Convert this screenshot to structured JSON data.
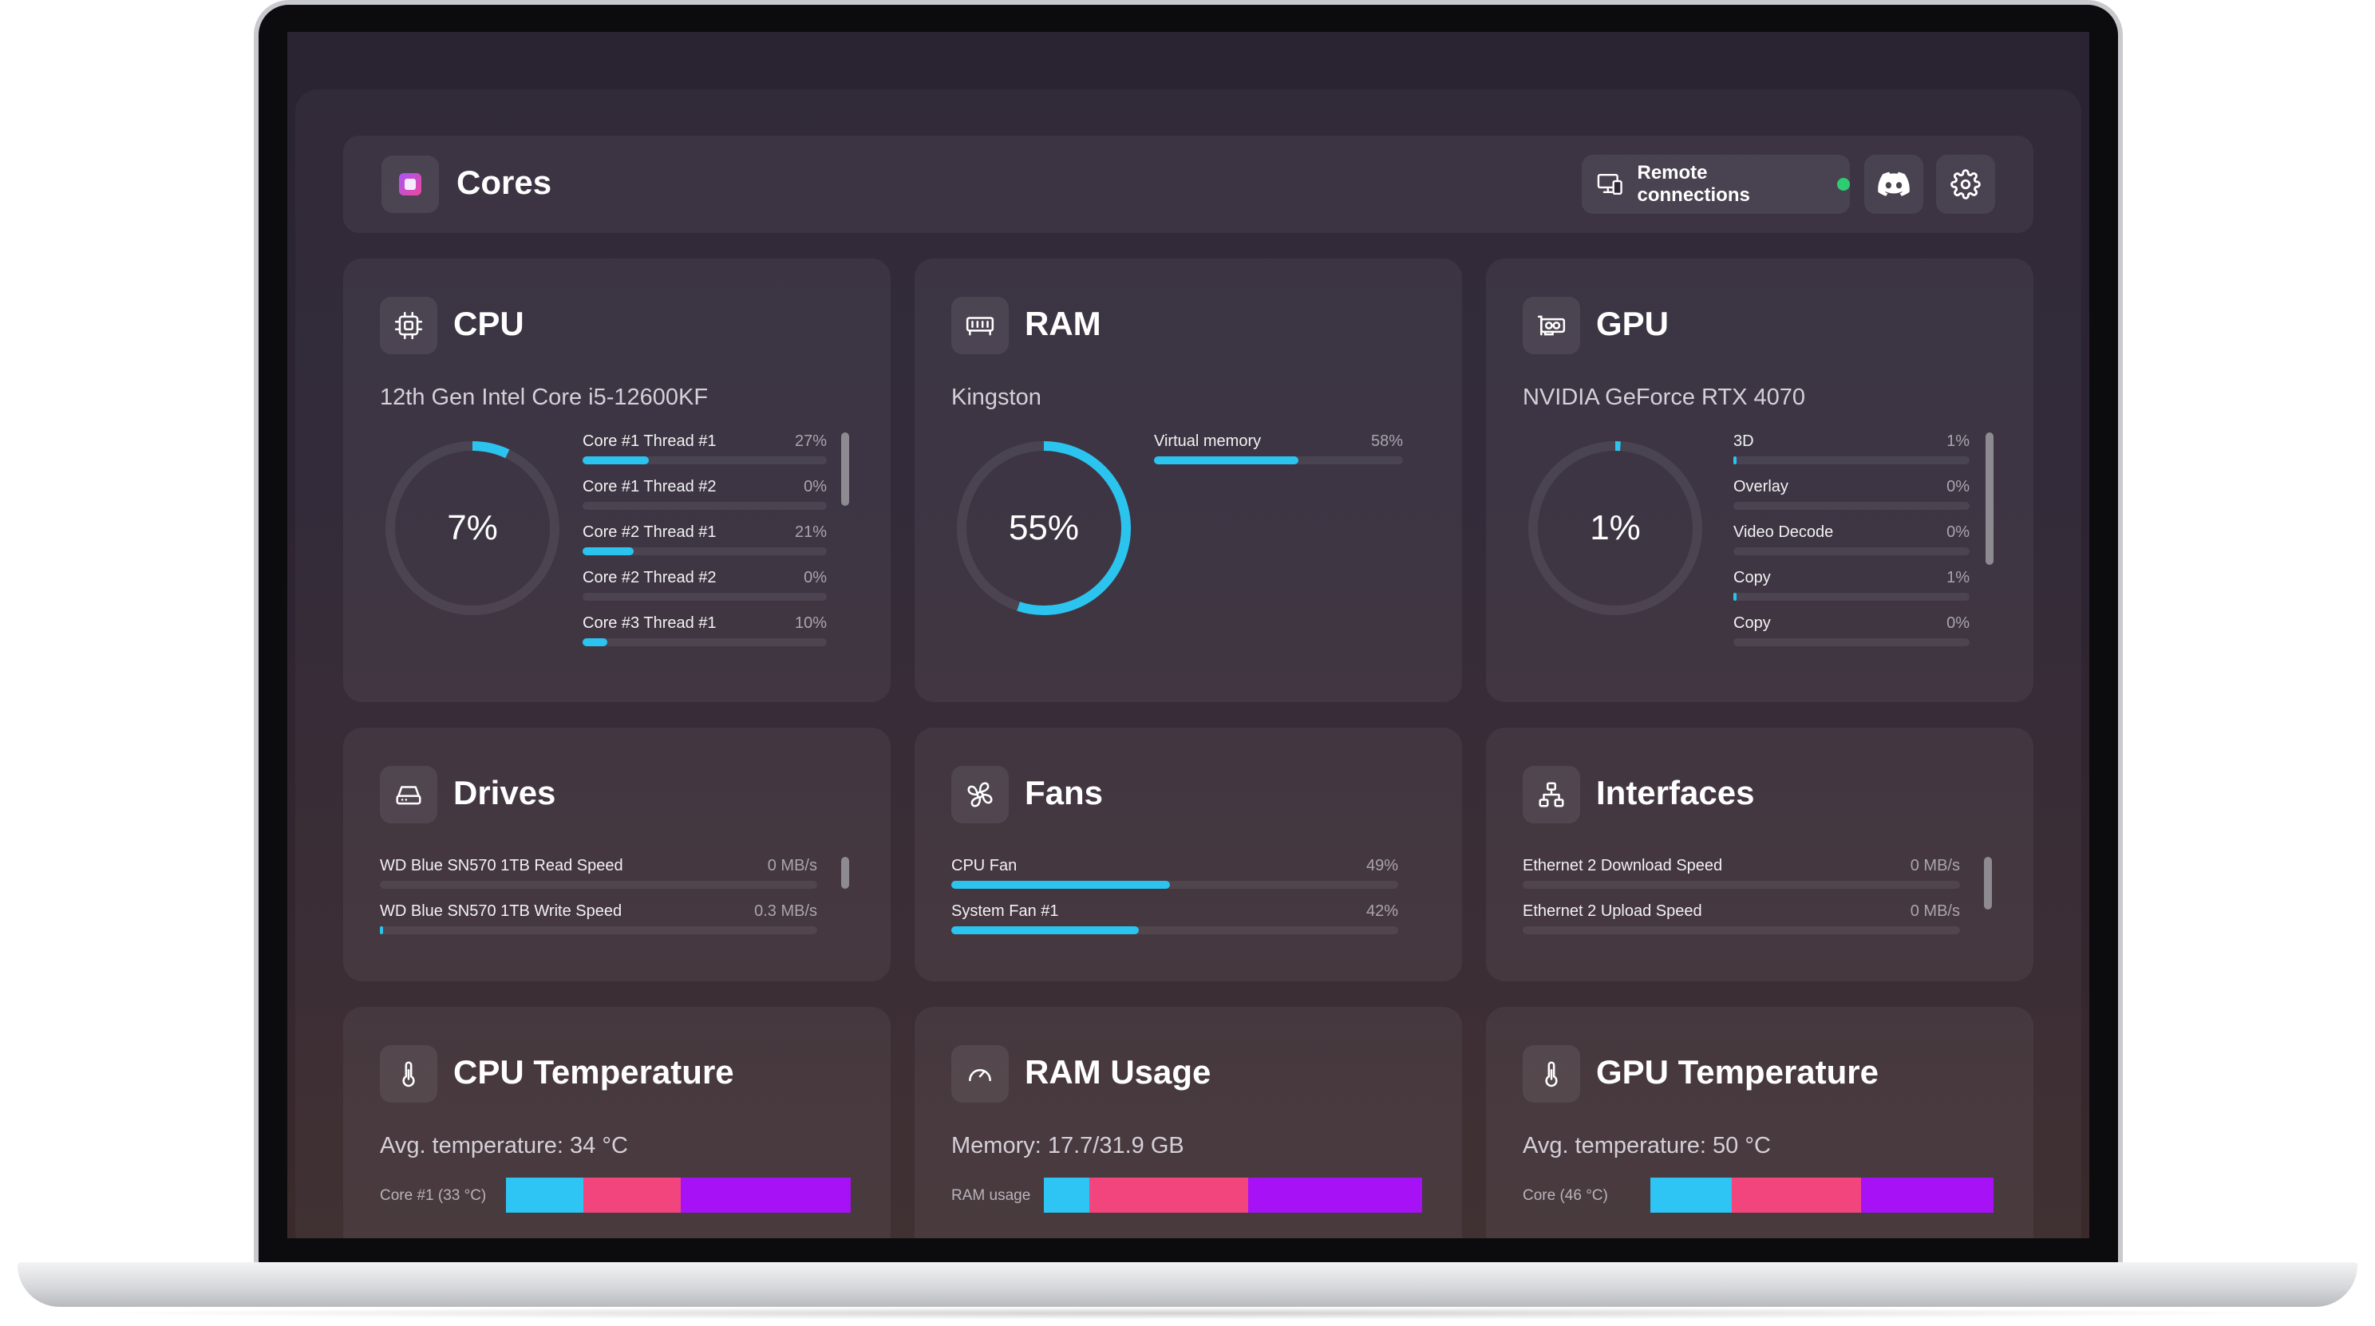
{
  "app": {
    "title": "Cores",
    "remote_label": "Remote connections"
  },
  "colors": {
    "accent": "#2bc4ef",
    "status_online": "#2ecc71",
    "seg_cyan": "#2ec4f3",
    "seg_pink": "#f3457d",
    "seg_purple": "#a711f5"
  },
  "cpu": {
    "title": "CPU",
    "model": "12th Gen Intel Core i5-12600KF",
    "usage": "7%",
    "usage_fraction": 0.07,
    "threads": [
      {
        "label": "Core #1 Thread #1",
        "value": "27%",
        "fraction": 0.27
      },
      {
        "label": "Core #1 Thread #2",
        "value": "0%",
        "fraction": 0
      },
      {
        "label": "Core #2 Thread #1",
        "value": "21%",
        "fraction": 0.21
      },
      {
        "label": "Core #2 Thread #2",
        "value": "0%",
        "fraction": 0
      },
      {
        "label": "Core #3 Thread #1",
        "value": "10%",
        "fraction": 0.1
      }
    ]
  },
  "ram": {
    "title": "RAM",
    "vendor": "Kingston",
    "usage": "55%",
    "usage_fraction": 0.55,
    "bars": [
      {
        "label": "Virtual memory",
        "value": "58%",
        "fraction": 0.58
      }
    ]
  },
  "gpu": {
    "title": "GPU",
    "model": "NVIDIA GeForce RTX 4070",
    "usage": "1%",
    "usage_fraction": 0.01,
    "engines": [
      {
        "label": "3D",
        "value": "1%",
        "fraction": 0.01
      },
      {
        "label": "Overlay",
        "value": "0%",
        "fraction": 0
      },
      {
        "label": "Video Decode",
        "value": "0%",
        "fraction": 0
      },
      {
        "label": "Copy",
        "value": "1%",
        "fraction": 0.01
      },
      {
        "label": "Copy",
        "value": "0%",
        "fraction": 0
      }
    ]
  },
  "drives": {
    "title": "Drives",
    "bars": [
      {
        "label": "WD Blue SN570 1TB Read Speed",
        "value": "0 MB/s",
        "fraction": 0
      },
      {
        "label": "WD Blue SN570 1TB Write Speed",
        "value": "0.3 MB/s",
        "fraction": 0.01
      }
    ]
  },
  "fans": {
    "title": "Fans",
    "bars": [
      {
        "label": "CPU Fan",
        "value": "49%",
        "fraction": 0.49
      },
      {
        "label": "System Fan #1",
        "value": "42%",
        "fraction": 0.42
      }
    ]
  },
  "interfaces": {
    "title": "Interfaces",
    "bars": [
      {
        "label": "Ethernet 2 Download Speed",
        "value": "0 MB/s",
        "fraction": 0
      },
      {
        "label": "Ethernet 2 Upload Speed",
        "value": "0 MB/s",
        "fraction": 0
      }
    ]
  },
  "cpu_temp": {
    "title": "CPU Temperature",
    "avg": "Avg. temperature: 34 °C",
    "core_label": "Core #1 (33 °C)"
  },
  "ram_usage": {
    "title": "RAM Usage",
    "memory": "Memory: 17.7/31.9 GB",
    "usage_label": "RAM usage"
  },
  "gpu_temp": {
    "title": "GPU Temperature",
    "avg": "Avg. temperature: 50 °C",
    "core_label": "Core (46 °C)"
  }
}
